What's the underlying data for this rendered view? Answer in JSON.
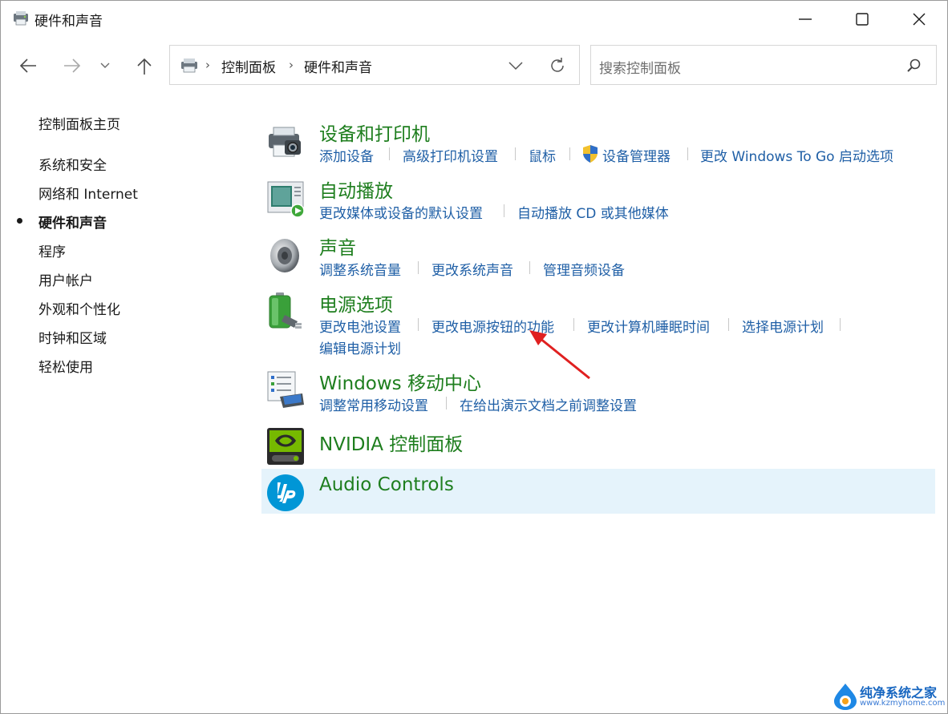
{
  "window": {
    "title": "硬件和声音",
    "icon": "control-panel-devices-icon"
  },
  "nav": {
    "back_icon": "arrow-left-icon",
    "forward_icon": "arrow-right-icon",
    "recent_icon": "chevron-down-icon",
    "up_icon": "arrow-up-icon"
  },
  "address": {
    "crumbs": [
      "控制面板",
      "硬件和声音"
    ],
    "separator": "›"
  },
  "search": {
    "placeholder": "搜索控制面板"
  },
  "sidebar": {
    "home": "控制面板主页",
    "items": [
      {
        "label": "系统和安全",
        "active": false
      },
      {
        "label": "网络和 Internet",
        "active": false
      },
      {
        "label": "硬件和声音",
        "active": true
      },
      {
        "label": "程序",
        "active": false
      },
      {
        "label": "用户帐户",
        "active": false
      },
      {
        "label": "外观和个性化",
        "active": false
      },
      {
        "label": "时钟和区域",
        "active": false
      },
      {
        "label": "轻松使用",
        "active": false
      }
    ]
  },
  "categories": [
    {
      "title": "设备和打印机",
      "icon": "printer-camera-icon",
      "links": [
        "添加设备",
        "高级打印机设置",
        "鼠标",
        "设备管理器",
        "更改 Windows To Go 启动选项"
      ]
    },
    {
      "title": "自动播放",
      "icon": "autoplay-icon",
      "links": [
        "更改媒体或设备的默认设置",
        "自动播放 CD 或其他媒体"
      ]
    },
    {
      "title": "声音",
      "icon": "speaker-icon",
      "links": [
        "调整系统音量",
        "更改系统声音",
        "管理音频设备"
      ]
    },
    {
      "title": "电源选项",
      "icon": "battery-icon",
      "links": [
        "更改电池设置",
        "更改电源按钮的功能",
        "更改计算机睡眠时间",
        "选择电源计划",
        "编辑电源计划"
      ]
    },
    {
      "title": "Windows 移动中心",
      "icon": "mobility-center-icon",
      "links": [
        "调整常用移动设置",
        "在给出演示文档之前调整设置"
      ]
    },
    {
      "title": "NVIDIA 控制面板",
      "icon": "nvidia-icon",
      "links": []
    },
    {
      "title": "Audio Controls",
      "icon": "hp-logo-icon",
      "links": []
    }
  ],
  "colors": {
    "category_title": "#1e7e1e",
    "link": "#1f5fa6",
    "highlight_row": "#e5f3fb",
    "annotation_arrow": "#e02020"
  },
  "watermark": {
    "title": "纯净系统之家",
    "url": "www.kzmyhome.com"
  }
}
